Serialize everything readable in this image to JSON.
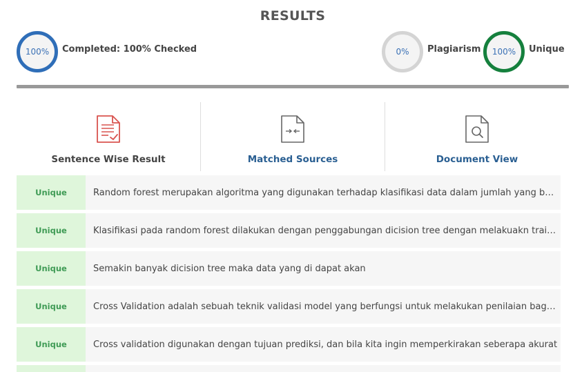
{
  "title": "RESULTS",
  "stats": {
    "completed": {
      "value": "100%",
      "label": "Completed: 100% Checked"
    },
    "plagiarism": {
      "value": "0%",
      "label": "Plagiarism"
    },
    "unique": {
      "value": "100%",
      "label": "Unique"
    }
  },
  "tabs": [
    {
      "label": "Sentence Wise Result",
      "icon": "document-check-icon"
    },
    {
      "label": "Matched Sources",
      "icon": "compare-icon"
    },
    {
      "label": "Document View",
      "icon": "document-search-icon"
    }
  ],
  "results": [
    {
      "status": "Unique",
      "text": "Random forest merupakan algoritma yang digunakan terhadap klasifikasi data dalam jumlah yang besar"
    },
    {
      "status": "Unique",
      "text": "Klasifikasi pada random forest dilakukan dengan penggabungan dicision tree dengan melakuakn training"
    },
    {
      "status": "Unique",
      "text": "Semakin banyak dicision tree maka data yang di dapat akan"
    },
    {
      "status": "Unique",
      "text": "Cross Validation adalah sebuah teknik validasi model yang berfungsi untuk melakukan penilaian bagaimana"
    },
    {
      "status": "Unique",
      "text": "Cross validation digunakan dengan tujuan prediksi, dan bila kita ingin memperkirakan seberapa akurat"
    }
  ],
  "colors": {
    "blue_ring": "#2f6eb8",
    "grey_ring": "#d4d4d4",
    "green_ring": "#15803d",
    "unique_badge_bg": "#dff6db",
    "unique_badge_text": "#3f9b55"
  }
}
